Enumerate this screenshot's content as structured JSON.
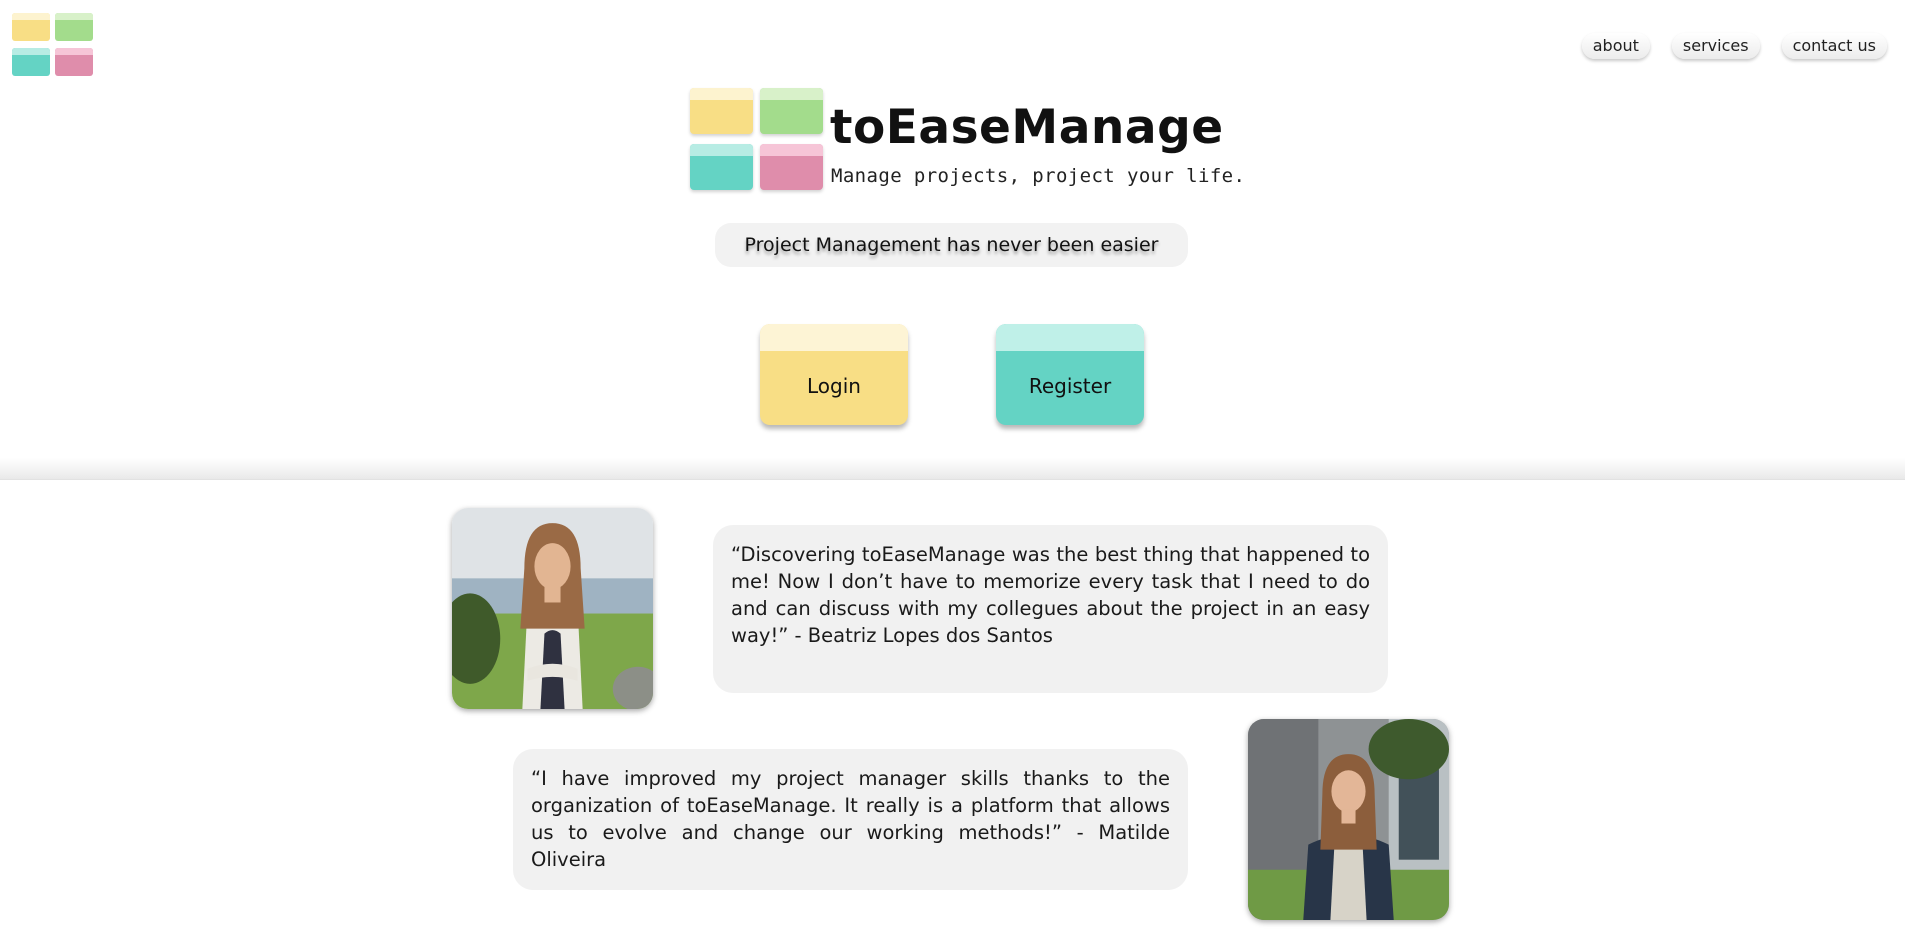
{
  "header": {
    "mini_logo_icon": "logo-tiles-icon",
    "nav": [
      {
        "label": "about"
      },
      {
        "label": "services"
      },
      {
        "label": "contact us"
      }
    ]
  },
  "brand": {
    "name": "toEaseManage",
    "tagline": "Manage projects, project your life.",
    "logo_icon": "logo-tiles-icon"
  },
  "hero": {
    "subtitle": "Project Management has never been easier",
    "login_label": "Login",
    "register_label": "Register"
  },
  "testimonials": [
    {
      "text": "“Discovering toEaseManage was the best thing that happened to me! Now I don’t have to memorize every task that I need to do and can discuss with my collegues about the project in an easy way!” - Beatriz Lopes dos Santos",
      "photo_icon": "user-photo-icon"
    },
    {
      "text": "“I have improved my project manager skills thanks to the organization of toEaseManage. It really is a platform that allows us to evolve and change our working methods!” - Matilde Oliveira",
      "photo_icon": "user-photo-icon"
    }
  ],
  "colors": {
    "yellow": "#f8de85",
    "green": "#a3dc8c",
    "teal": "#64d3c4",
    "pink": "#df8dab",
    "panel": "#f1f1f1"
  }
}
